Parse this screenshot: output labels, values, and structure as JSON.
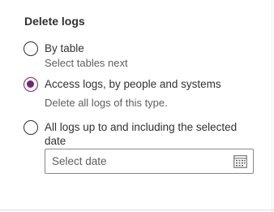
{
  "section": {
    "title": "Delete logs"
  },
  "options": [
    {
      "label": "By table",
      "description": "Select tables next",
      "selected": false
    },
    {
      "label": "Access logs, by people and systems",
      "description": "Delete all logs of this type.",
      "selected": true
    },
    {
      "label": "All logs up to and including the selected date",
      "selected": false
    }
  ],
  "date_picker": {
    "placeholder": "Select date",
    "value": "",
    "icon": "calendar-icon"
  },
  "colors": {
    "accent": "#742774",
    "text": "#323130",
    "secondary_text": "#605e5c",
    "border": "#8a8886"
  }
}
